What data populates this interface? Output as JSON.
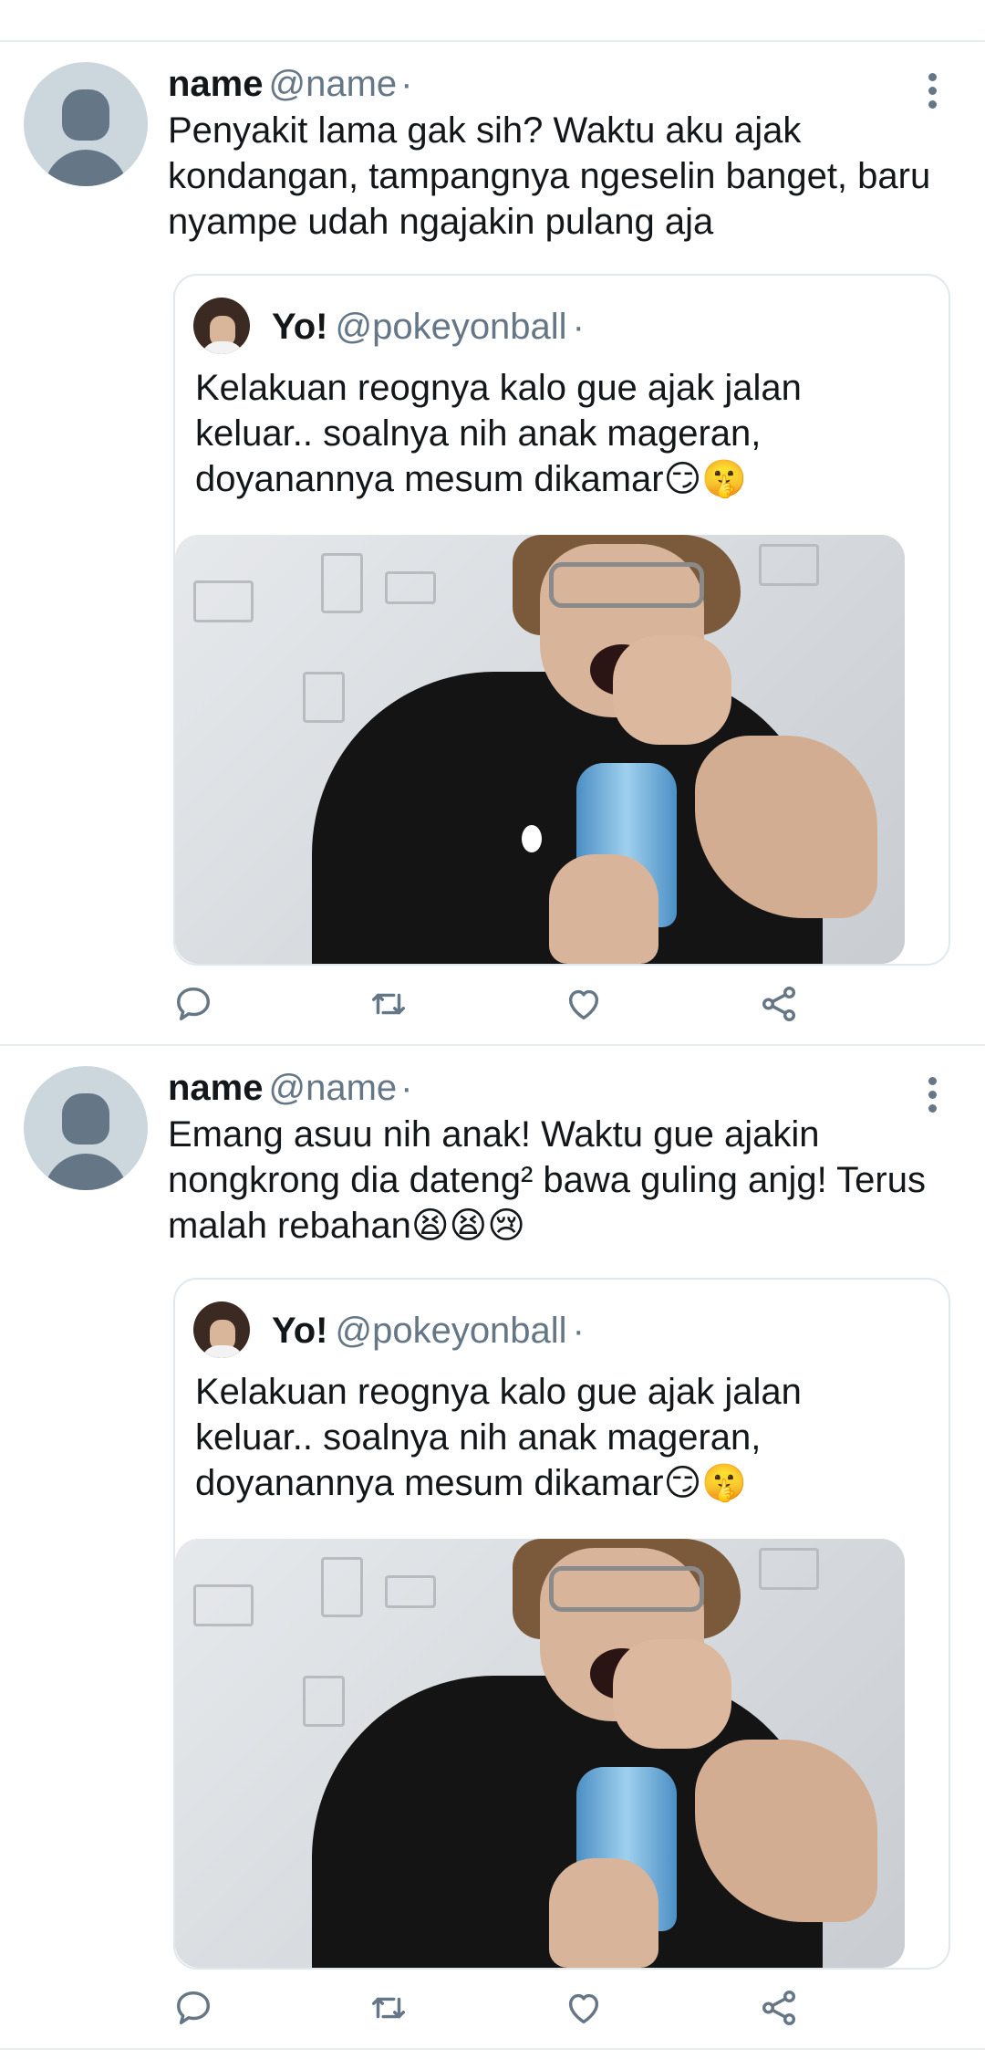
{
  "tweets": [
    {
      "author_name": "name",
      "author_handle": "@name",
      "separator": "·",
      "text": "Penyakit lama gak sih? Waktu aku ajak kondangan, tampangnya ngeselin banget, baru nyampe udah ngajakin pulang aja",
      "quote": {
        "author_name": "Yo!",
        "author_handle": "@pokeyonball",
        "separator": "·",
        "text": "Kelakuan reognya kalo gue ajak jalan keluar.. soalnya nih anak mageran, doyanannya mesum dikamar😏🤫"
      }
    },
    {
      "author_name": "name",
      "author_handle": "@name",
      "separator": "·",
      "text": "Emang asuu nih anak! Waktu gue ajakin nongkrong dia dateng² bawa guling anjg! Terus malah rebahan😫😫😢",
      "quote": {
        "author_name": "Yo!",
        "author_handle": "@pokeyonball",
        "separator": "·",
        "text": "Kelakuan reognya kalo gue ajak jalan keluar.. soalnya nih anak mageran, doyanannya mesum dikamar😏🤫"
      }
    }
  ],
  "icons": {
    "reply": "reply-icon",
    "retweet": "retweet-icon",
    "like": "like-icon",
    "share": "share-icon",
    "more": "more-vertical-icon"
  },
  "colors": {
    "secondary_text": "#657786",
    "divider": "#e6ecf0",
    "avatar_placeholder": "#ccd6dd"
  }
}
